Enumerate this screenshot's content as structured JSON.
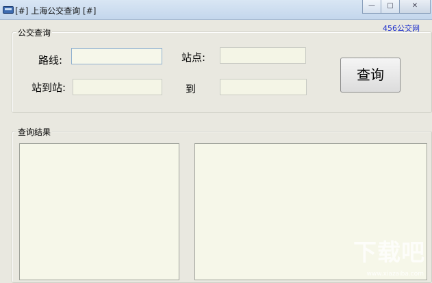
{
  "window": {
    "title": "[#] 上海公交查询 [#]",
    "controls": {
      "minimize": "—",
      "maximize": "□",
      "close": "✕"
    }
  },
  "link": {
    "text": "456公交网"
  },
  "query_group": {
    "legend": "公交查询",
    "route_label": "路线:",
    "station_label": "站点:",
    "station_to_station_label": "站到站:",
    "to_label": "到",
    "route_value": "",
    "station_value": "",
    "from_station_value": "",
    "to_station_value": "",
    "query_button": "查询"
  },
  "results_group": {
    "legend": "查询结果"
  },
  "watermark": {
    "text": "下载吧",
    "url": "www.xiazaiba.com"
  }
}
